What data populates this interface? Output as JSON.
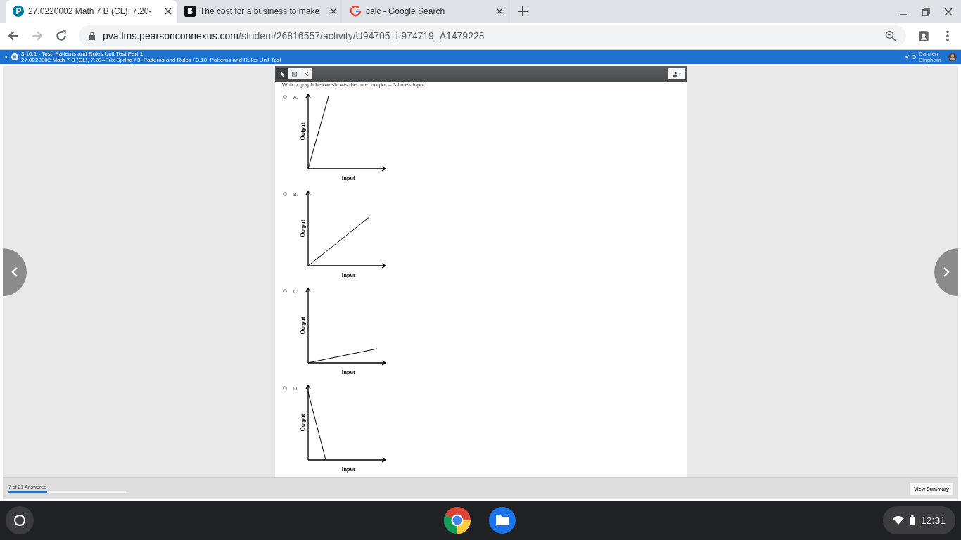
{
  "browser": {
    "tabs": [
      {
        "title": "27.0220002 Math 7 B (CL), 7.20-",
        "selected": true,
        "kind": "pearson"
      },
      {
        "title": "The cost for a business to make",
        "selected": false,
        "kind": "brainly"
      },
      {
        "title": "calc - Google Search",
        "selected": false,
        "kind": "google"
      }
    ],
    "url_host": "pva.lms.pearsonconnexus.com",
    "url_path": "/student/26816557/activity/U94705_L974719_A1479228"
  },
  "header": {
    "title": "3.10.1 - Test: Patterns and Rules Unit Test Part 1",
    "breadcrumb": "27.0220002 Math 7 B (CL), 7.20--Frix Spring / 3. Patterns and Rules / 3.10. Patterns and Rules Unit Test",
    "user": "Damien Bingham"
  },
  "toolbar": {
    "tools": [
      {
        "kind": "pointer",
        "selected": true
      },
      {
        "kind": "note",
        "selected": false
      },
      {
        "kind": "eliminate",
        "selected": false
      }
    ]
  },
  "question": {
    "prompt": "Which graph below shows the rule: output = 3 times input.",
    "options": [
      {
        "letter": "A.",
        "selected": false,
        "kind": "steep",
        "ylabel": "Output",
        "xlabel": "Input"
      },
      {
        "letter": "B.",
        "selected": false,
        "kind": "medium",
        "ylabel": "Output",
        "xlabel": "Input"
      },
      {
        "letter": "C.",
        "selected": false,
        "kind": "shallow",
        "ylabel": "Output",
        "xlabel": "Input"
      },
      {
        "letter": "D.",
        "selected": false,
        "kind": "decreasing",
        "ylabel": "Output",
        "xlabel": "Input"
      }
    ]
  },
  "footer": {
    "progress_text": "7 of 21 Answered",
    "progress": {
      "level": 0.33
    },
    "summary_button": "View Summary"
  },
  "shelf": {
    "time": "12:31"
  }
}
